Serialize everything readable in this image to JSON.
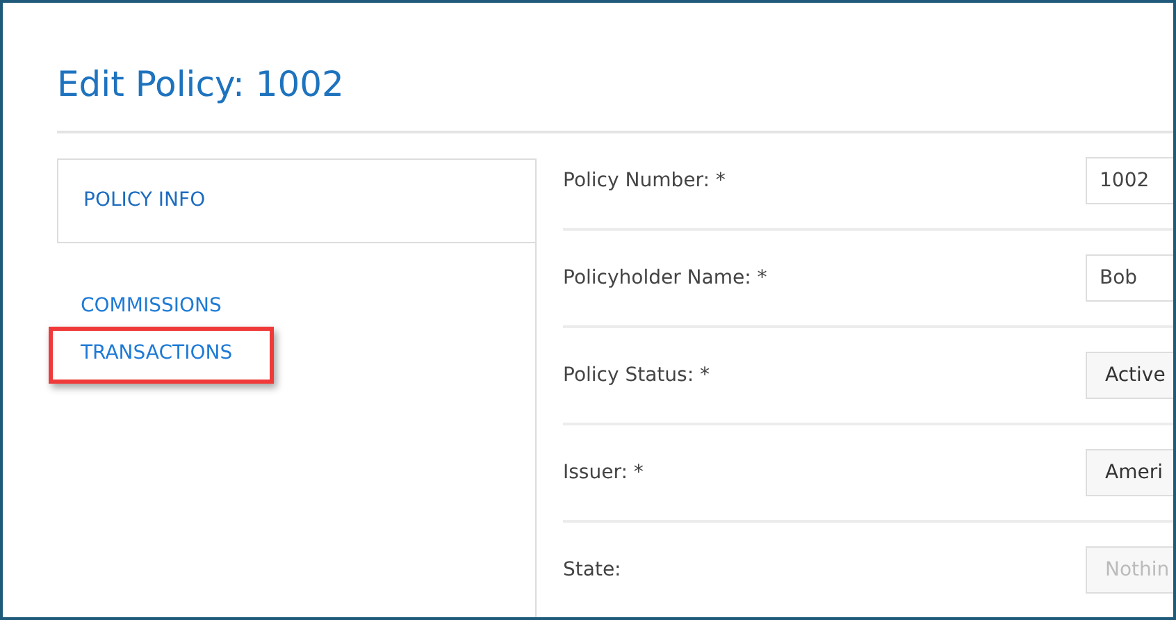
{
  "page": {
    "title": "Edit Policy: 1002"
  },
  "tabs": [
    {
      "label": "POLICY INFO",
      "selected": true,
      "highlighted": false
    },
    {
      "label": "COMMISSIONS",
      "selected": false,
      "highlighted": false
    },
    {
      "label": "TRANSACTIONS",
      "selected": false,
      "highlighted": true
    }
  ],
  "fields": [
    {
      "label": "Policy Number: *",
      "kind": "input",
      "value": "1002"
    },
    {
      "label": "Policyholder Name: *",
      "kind": "input",
      "value": "Bob"
    },
    {
      "label": "Policy Status: *",
      "kind": "select",
      "value": "Active"
    },
    {
      "label": "Issuer: *",
      "kind": "select",
      "value": "Ameri"
    },
    {
      "label": "State:",
      "kind": "select",
      "placeholder": "Nothin"
    }
  ]
}
